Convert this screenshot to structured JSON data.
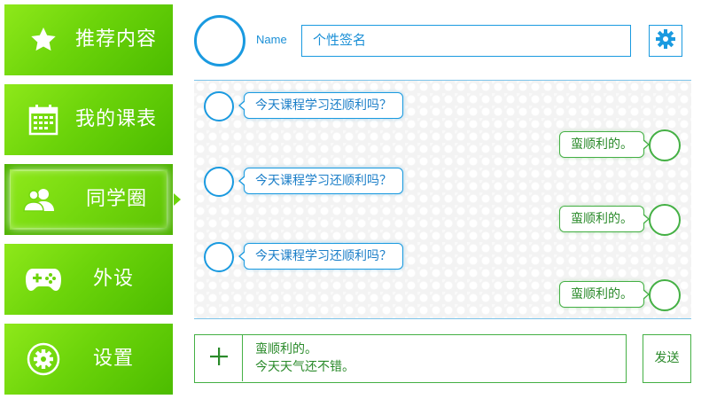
{
  "sidebar": {
    "items": [
      {
        "label": "推荐内容",
        "icon": "star-icon"
      },
      {
        "label": "我的课表",
        "icon": "calendar-icon"
      },
      {
        "label": "同学圈",
        "icon": "people-icon"
      },
      {
        "label": "外设",
        "icon": "gamepad-icon"
      },
      {
        "label": "设置",
        "icon": "gear-icon"
      }
    ],
    "active_index": 2
  },
  "header": {
    "name_label": "Name",
    "signature_placeholder": "个性签名"
  },
  "chat": {
    "messages": [
      {
        "direction": "in",
        "text": "今天课程学习还顺利吗？"
      },
      {
        "direction": "out",
        "text": "蛮顺利的。"
      },
      {
        "direction": "in",
        "text": "今天课程学习还顺利吗？"
      },
      {
        "direction": "out",
        "text": "蛮顺利的。"
      },
      {
        "direction": "in",
        "text": "今天课程学习还顺利吗？"
      },
      {
        "direction": "out",
        "text": "蛮顺利的。"
      }
    ]
  },
  "composer": {
    "lines": [
      "蛮顺利的。",
      "今天天气还不错。"
    ],
    "send_label": "发送"
  },
  "colors": {
    "green_accent": "#6cd40a",
    "blue_accent": "#1a9ae0",
    "chat_green": "#44b044"
  }
}
